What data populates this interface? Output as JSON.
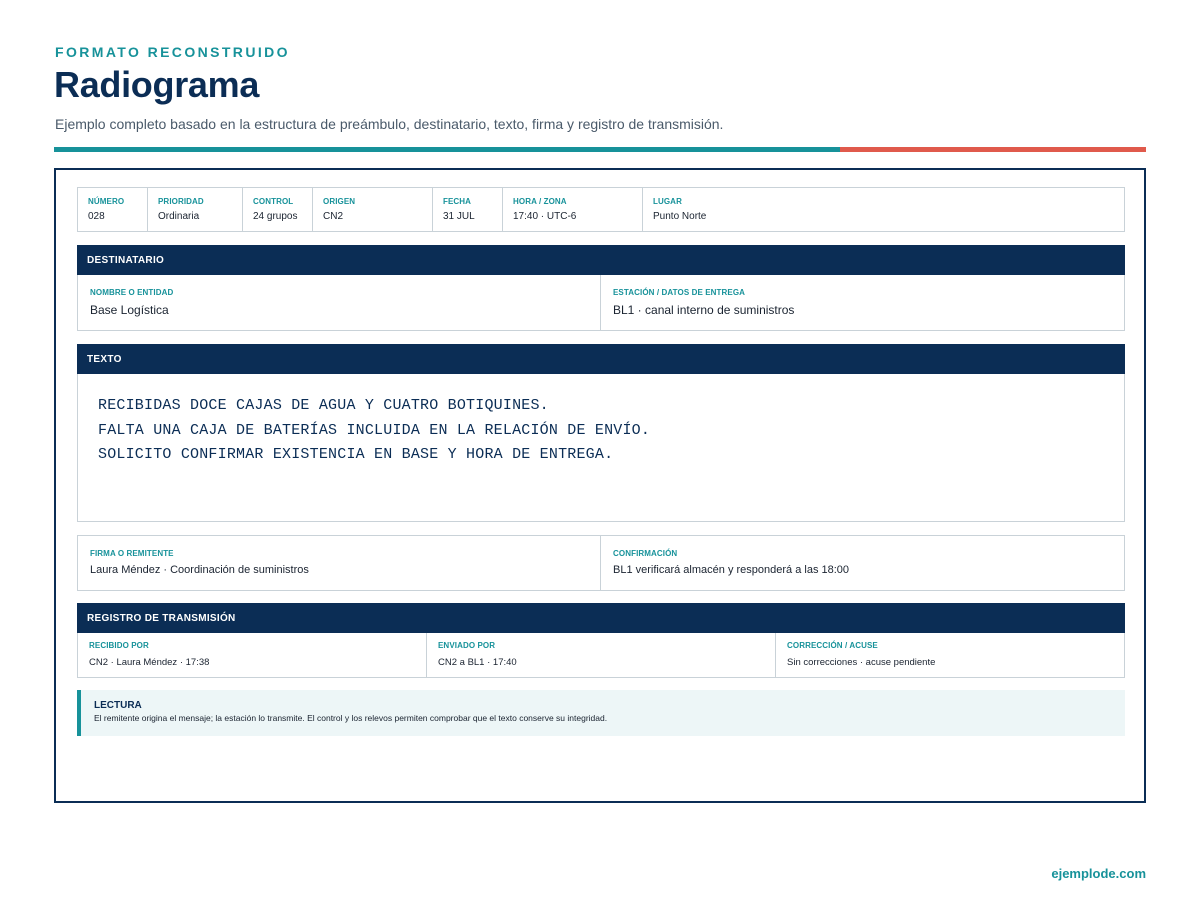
{
  "header": {
    "kicker": "FORMATO RECONSTRUIDO",
    "title": "Radiograma",
    "subtitle": "Ejemplo completo basado en la estructura de preámbulo, destinatario, texto, firma y registro de transmisión."
  },
  "preamble": [
    {
      "label": "NÚMERO",
      "value": "028"
    },
    {
      "label": "PRIORIDAD",
      "value": "Ordinaria"
    },
    {
      "label": "CONTROL",
      "value": "24 grupos"
    },
    {
      "label": "ORIGEN",
      "value": "CN2"
    },
    {
      "label": "FECHA",
      "value": "31 JUL"
    },
    {
      "label": "HORA / ZONA",
      "value": "17:40 · UTC-6"
    },
    {
      "label": "LUGAR",
      "value": "Punto Norte"
    }
  ],
  "destinatario": {
    "title": "DESTINATARIO",
    "entity_label": "NOMBRE O ENTIDAD",
    "entity_value": "Base Logística",
    "station_label": "ESTACIÓN / DATOS DE ENTREGA",
    "station_value": "BL1 · canal interno de suministros"
  },
  "texto": {
    "title": "TEXTO",
    "lines": [
      "RECIBIDAS DOCE CAJAS DE AGUA Y CUATRO BOTIQUINES.",
      "FALTA UNA CAJA DE BATERÍAS INCLUIDA EN LA RELACIÓN DE ENVÍO.",
      "SOLICITO CONFIRMAR EXISTENCIA EN BASE Y HORA DE ENTREGA."
    ]
  },
  "firma": {
    "sender_label": "FIRMA O REMITENTE",
    "sender_value": "Laura Méndez · Coordinación de suministros",
    "confirm_label": "CONFIRMACIÓN",
    "confirm_value": "BL1 verificará almacén y responderá a las 18:00"
  },
  "registro": {
    "title": "REGISTRO DE TRANSMISIÓN",
    "received_label": "RECIBIDO POR",
    "received_value": "CN2 · Laura Méndez · 17:38",
    "sent_label": "ENVIADO POR",
    "sent_value": "CN2 a BL1 · 17:40",
    "correction_label": "CORRECCIÓN / ACUSE",
    "correction_value": "Sin correcciones · acuse pendiente"
  },
  "lectura": {
    "title": "LECTURA",
    "text": "El remitente origina el mensaje; la estación lo transmite. El control y los relevos permiten comprobar que el texto conserve su integridad."
  },
  "footer": {
    "site": "ejemplode.com"
  },
  "colors": {
    "navy": "#0b2d55",
    "teal": "#17929a",
    "red": "#e05a4c"
  }
}
